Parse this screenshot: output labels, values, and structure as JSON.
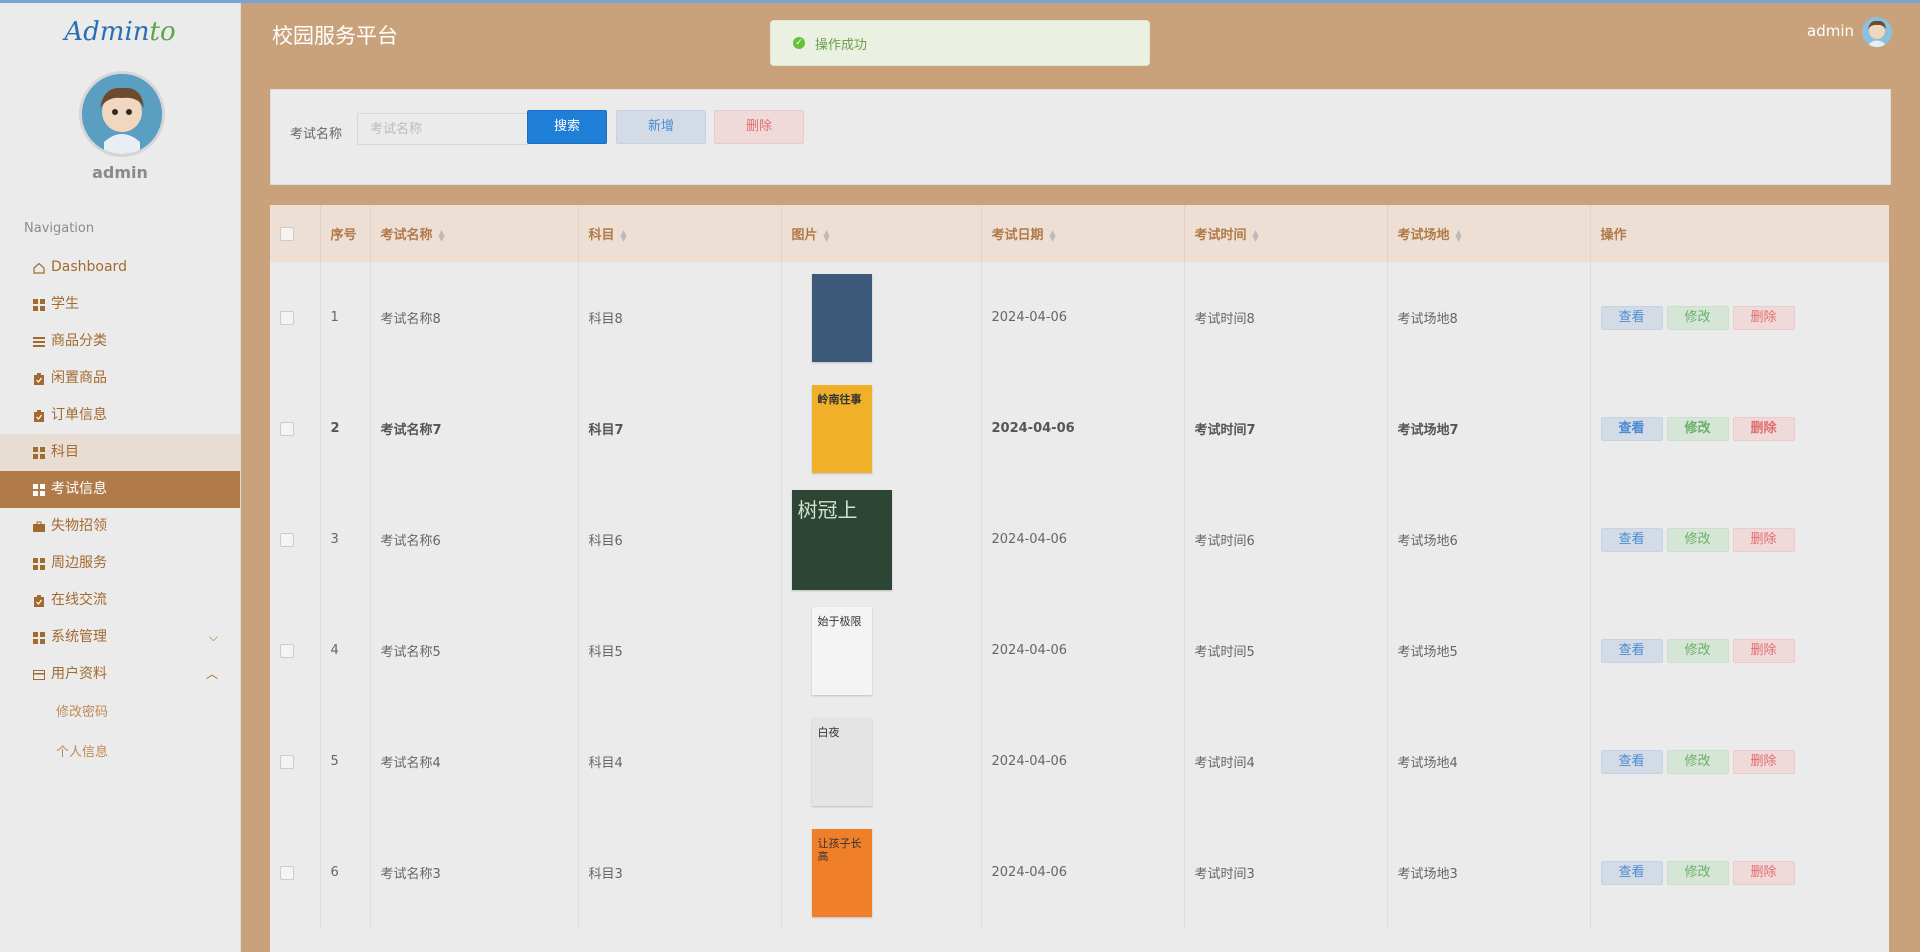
{
  "brand": {
    "logo_main": "Admin",
    "logo_accent": "to",
    "user": "admin"
  },
  "nav": {
    "heading": "Navigation",
    "items": [
      {
        "label": "Dashboard",
        "icon": "home-icon"
      },
      {
        "label": "学生",
        "icon": "grid-icon"
      },
      {
        "label": "商品分类",
        "icon": "list-icon"
      },
      {
        "label": "闲置商品",
        "icon": "clipboard-icon"
      },
      {
        "label": "订单信息",
        "icon": "clipboard-icon"
      },
      {
        "label": "科目",
        "icon": "grid-icon"
      },
      {
        "label": "考试信息",
        "icon": "grid-icon"
      },
      {
        "label": "失物招领",
        "icon": "briefcase-icon"
      },
      {
        "label": "周边服务",
        "icon": "grid-icon"
      },
      {
        "label": "在线交流",
        "icon": "clipboard-icon"
      },
      {
        "label": "系统管理",
        "icon": "grid-icon"
      },
      {
        "label": "用户资料",
        "icon": "card-icon"
      }
    ],
    "sub_items": [
      "修改密码",
      "个人信息"
    ]
  },
  "header": {
    "title": "校园服务平台",
    "toast": "操作成功",
    "user": "admin"
  },
  "search": {
    "label": "考试名称",
    "placeholder": "考试名称",
    "search_btn": "搜索",
    "add_btn": "新增",
    "delete_btn": "删除"
  },
  "table": {
    "columns": [
      "序号",
      "考试名称",
      "科目",
      "图片",
      "考试日期",
      "考试时间",
      "考试场地",
      "操作"
    ],
    "actions": {
      "view": "查看",
      "edit": "修改",
      "delete": "删除"
    },
    "rows": [
      {
        "no": "1",
        "name": "考试名称8",
        "subject": "科目8",
        "date": "2024-04-06",
        "time": "考试时间8",
        "place": "考试场地8",
        "cover": {
          "bg": "#3d5a7a",
          "text": ""
        }
      },
      {
        "no": "2",
        "name": "考试名称7",
        "subject": "科目7",
        "date": "2024-04-06",
        "time": "考试时间7",
        "place": "考试场地7",
        "cover": {
          "bg": "#f0b02a",
          "text": "岭南往事"
        }
      },
      {
        "no": "3",
        "name": "考试名称6",
        "subject": "科目6",
        "date": "2024-04-06",
        "time": "考试时间6",
        "place": "考试场地6",
        "cover": {
          "bg": "#2d4534",
          "text": "树冠上"
        }
      },
      {
        "no": "4",
        "name": "考试名称5",
        "subject": "科目5",
        "date": "2024-04-06",
        "time": "考试时间5",
        "place": "考试场地5",
        "cover": {
          "bg": "#f4f4f4",
          "text": "始于极限"
        }
      },
      {
        "no": "5",
        "name": "考试名称4",
        "subject": "科目4",
        "date": "2024-04-06",
        "time": "考试时间4",
        "place": "考试场地4",
        "cover": {
          "bg": "#e4e4e4",
          "text": "白夜"
        }
      },
      {
        "no": "6",
        "name": "考试名称3",
        "subject": "科目3",
        "date": "2024-04-06",
        "time": "考试时间3",
        "place": "考试场地3",
        "cover": {
          "bg": "#f07f2a",
          "text": "让孩子长高"
        }
      }
    ]
  }
}
